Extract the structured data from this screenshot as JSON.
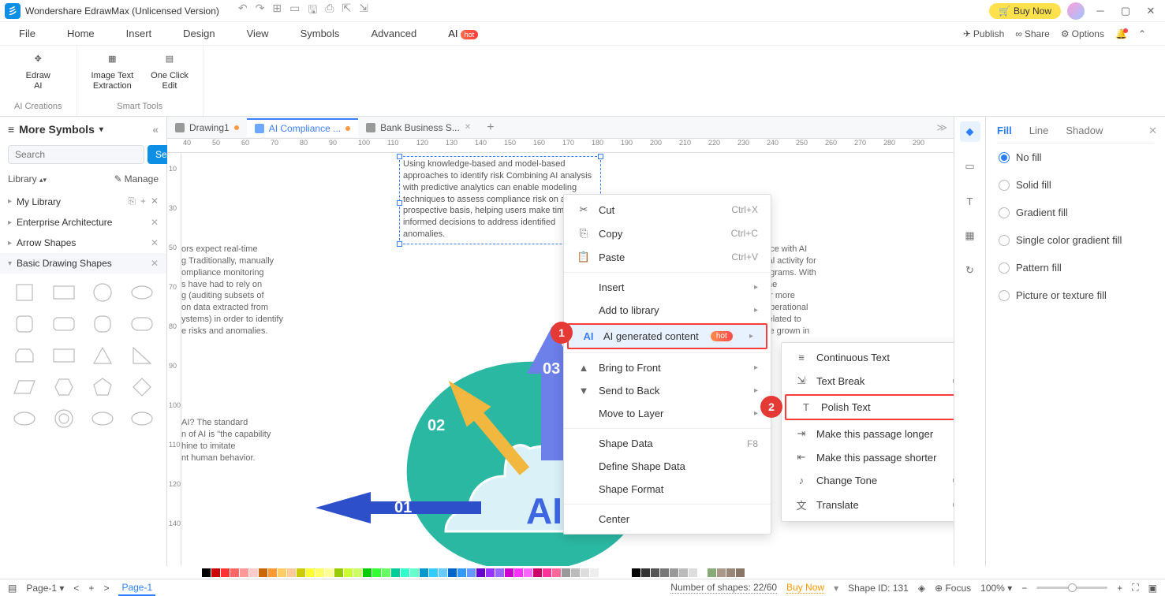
{
  "title": "Wondershare EdrawMax (Unlicensed Version)",
  "title_buttons": {
    "buy_now": "Buy Now"
  },
  "menu": {
    "file": "File",
    "home": "Home",
    "insert": "Insert",
    "design": "Design",
    "view": "View",
    "symbols": "Symbols",
    "advanced": "Advanced",
    "ai": "AI",
    "hot": "hot",
    "publish": "Publish",
    "share": "Share",
    "options": "Options"
  },
  "ribbon": {
    "group1_label": "AI Creations",
    "group2_label": "Smart Tools",
    "edraw_ai": "Edraw\nAI",
    "image_text": "Image Text\nExtraction",
    "one_click": "One Click\nEdit"
  },
  "sidebar": {
    "more_symbols": "More Symbols",
    "search_placeholder": "Search",
    "search_btn": "Search",
    "library": "Library",
    "manage": "Manage",
    "cats": {
      "my_library": "My Library",
      "enterprise": "Enterprise Architecture",
      "arrow": "Arrow Shapes",
      "basic": "Basic Drawing Shapes"
    }
  },
  "doc_tabs": {
    "t1": "Drawing1",
    "t2": "AI Compliance ...",
    "t3": "Bank Business S..."
  },
  "ruler_h": [
    "40",
    "50",
    "60",
    "70",
    "80",
    "90",
    "100",
    "110",
    "120",
    "130",
    "140",
    "150",
    "160",
    "170",
    "180",
    "190",
    "200",
    "210",
    "220",
    "230",
    "240",
    "250",
    "260",
    "270",
    "280",
    "290"
  ],
  "ruler_v": [
    "10",
    "30",
    "50",
    "70",
    "80",
    "90",
    "100",
    "110",
    "120",
    "140"
  ],
  "canvas": {
    "sel_text": "Using knowledge-based and model-based approaches to identify risk Combining AI analysis with predictive analytics can enable modeling techniques to assess compliance risk on a prospective basis, helping users make timely and informed decisions to address identified anomalies.",
    "left_text1": "ors expect real-time\ng Traditionally, manually\nompliance monitoring\ns have had to rely on\ng (auditing subsets of\non data extracted from\nystems) in order to identify\ne risks and anomalies.",
    "left_text2": "AI? The standard\nn of AI is \"the capability\nhine to imitate\nnt human behavior.",
    "right_text": "nce with AI\nral activity for\nngrams. With\nthe\nor more\noperational\nrelated to\nve grown in",
    "center": "AI",
    "a1": "01",
    "a2": "02",
    "a3": "03"
  },
  "ctx1": {
    "cut": "Cut",
    "cut_k": "Ctrl+X",
    "copy": "Copy",
    "copy_k": "Ctrl+C",
    "paste": "Paste",
    "paste_k": "Ctrl+V",
    "insert": "Insert",
    "add_lib": "Add to library",
    "ai_gen": "AI generated content",
    "hot": "hot",
    "bring_front": "Bring to Front",
    "send_back": "Send to Back",
    "move_layer": "Move to Layer",
    "shape_data": "Shape Data",
    "shape_data_k": "F8",
    "define_shape": "Define Shape Data",
    "shape_format": "Shape Format",
    "center": "Center"
  },
  "ctx2": {
    "continuous": "Continuous Text",
    "text_break": "Text Break",
    "polish": "Polish Text",
    "longer": "Make this passage longer",
    "shorter": "Make this passage shorter",
    "tone": "Change Tone",
    "translate": "Translate"
  },
  "right_panel": {
    "tabs": {
      "fill": "Fill",
      "line": "Line",
      "shadow": "Shadow"
    },
    "opts": {
      "no_fill": "No fill",
      "solid": "Solid fill",
      "gradient": "Gradient fill",
      "single_grad": "Single color gradient fill",
      "pattern": "Pattern fill",
      "picture": "Picture or texture fill"
    }
  },
  "status": {
    "page_sel": "Page-1",
    "page_tab": "Page-1",
    "shapes": "Number of shapes: 22/60",
    "buy_now": "Buy Now",
    "shape_id": "Shape ID: 131",
    "focus": "Focus",
    "zoom": "100%"
  },
  "callouts": {
    "c1": "1",
    "c2": "2"
  }
}
